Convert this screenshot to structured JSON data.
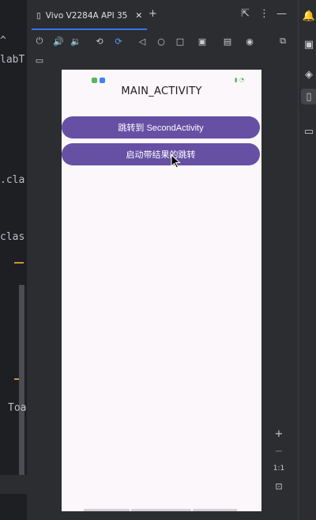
{
  "editor": {
    "fragments": [
      "^ ",
      "labT",
      ".cla",
      "clas",
      "Toa"
    ]
  },
  "emulator": {
    "tab_label": "Vivo V2284A API 35",
    "phone": {
      "title": "MAIN_ACTIVITY",
      "buttons": [
        "跳转到 SecondActivity",
        "启动带结果的跳转"
      ]
    },
    "zoom": {
      "plus": "+",
      "minus": "−",
      "ratio": "1:1"
    }
  },
  "colors": {
    "button": "#6650a4",
    "phone_bg": "#fcf7fb",
    "ide_bg": "#2b2d30",
    "accent": "#3574f0"
  }
}
